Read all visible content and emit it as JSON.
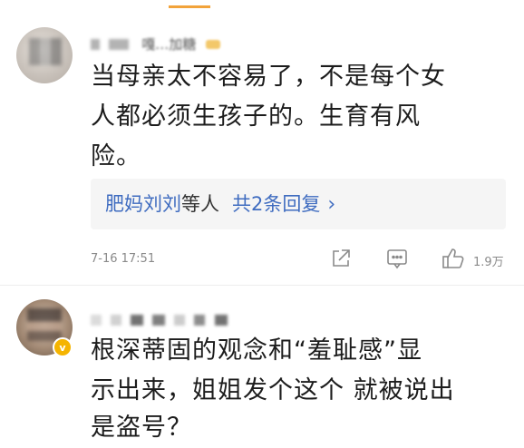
{
  "comments": [
    {
      "username": "嘎…加糖",
      "text_line1": "当母亲太不容易了，不是每个女",
      "text_line2": "人都必须生孩子的。生育有风",
      "text_line3": "险。",
      "replies": {
        "names": "肥妈刘刘",
        "suffix": "等人",
        "count": "共2条回复",
        "arrow": "›"
      },
      "time": "7-16 17:51",
      "likes": "1.9万",
      "icons": [
        "share-icon",
        "comment-icon",
        "like-icon"
      ]
    },
    {
      "username": "",
      "text_line1": "根深蒂固的观念和“羞耻感”显",
      "text_line2": "示出来，姐姐发个这个 就被说出",
      "text_line3": "是盗号？",
      "badge": "v"
    }
  ],
  "colors": {
    "link": "#3f6cc0",
    "meta": "#8a8a8a",
    "reply_bg": "#f5f5f5",
    "verified_badge": "#f5b400"
  }
}
